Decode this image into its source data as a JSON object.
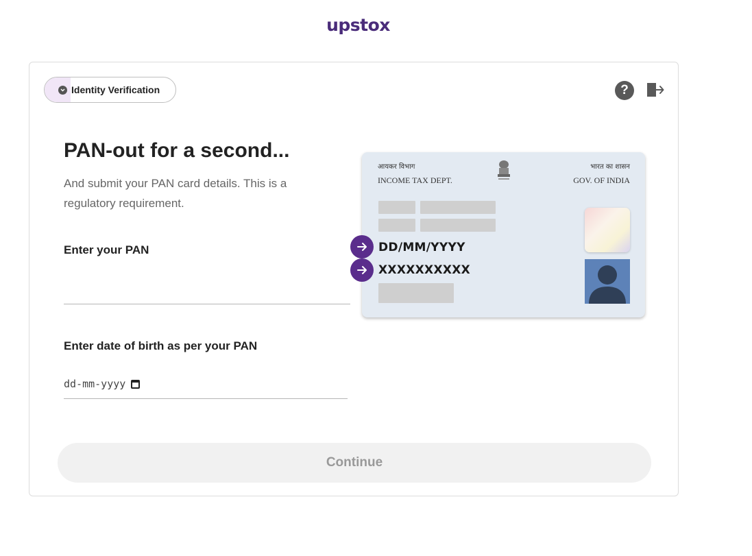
{
  "brand": {
    "logo_text": "upstox"
  },
  "header": {
    "step_label": "Identity Verification"
  },
  "main": {
    "title": "PAN-out for a second...",
    "subtitle": "And submit your PAN card details. This is a regulatory requirement.",
    "pan_label": "Enter your PAN",
    "pan_value": "",
    "dob_label": "Enter date of birth as per your PAN",
    "dob_placeholder": "dd-mm-yyyy",
    "continue_label": "Continue"
  },
  "pan_card": {
    "hindi_left": "आयकर विभाग",
    "hindi_right": "भारत का शासन",
    "dept": "INCOME TAX DEPT.",
    "gov": "GOV. OF INDIA",
    "dob_mask": "DD/MM/YYYY",
    "pan_mask": "XXXXXXXXXX"
  },
  "icons": {
    "help": "help-circle-icon",
    "exit": "logout-icon",
    "step": "chevron-down-icon",
    "arrows": "arrow-right-icon"
  },
  "colors": {
    "brand": "#4a2c7a",
    "arrow_accent": "#5a2d8c",
    "card_bg": "#e3eaf2"
  }
}
